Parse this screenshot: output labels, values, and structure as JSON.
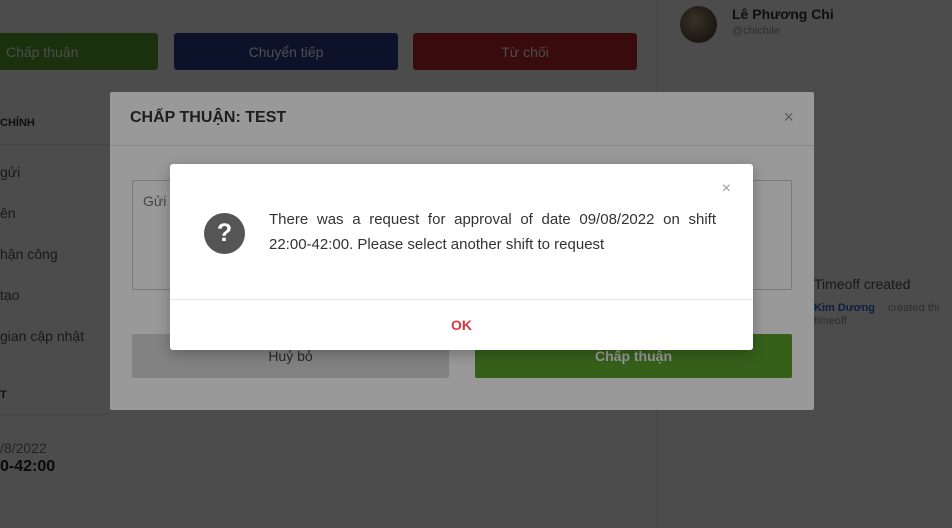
{
  "actions": {
    "approve": "Chấp thuận",
    "forward": "Chuyển tiếp",
    "reject": "Từ chối"
  },
  "user": {
    "name": "Lê Phương Chi",
    "handle": "@chichile"
  },
  "sidebar": {
    "section_title": "CHÍNH",
    "items": [
      "gửi",
      "ên",
      "hận công",
      "tạo",
      "gian cập nhật"
    ],
    "second_section_title": "T",
    "date": "/8/2022",
    "shift": "0-42:00"
  },
  "activity": {
    "title": "Timeoff created",
    "actor": "Kim Dương",
    "verb": "created thi",
    "object": "timeoff"
  },
  "approve_modal": {
    "title": "CHẤP THUẬN: TEST",
    "close_glyph": "×",
    "textarea_placeholder": "Gửi",
    "cancel_label": "Huỷ bỏ",
    "submit_label": "Chấp thuận"
  },
  "alert": {
    "close_glyph": "×",
    "icon_glyph": "?",
    "message": "There was a request for approval of date 09/08/2022 on shift 22:00-42:00. Please select another shift to request",
    "ok_label": "OK"
  },
  "colors": {
    "approve": "#5aa02c",
    "forward": "#2c3e91",
    "reject": "#c0262c",
    "ok_text": "#d9383d",
    "link": "#2d6bd6"
  }
}
